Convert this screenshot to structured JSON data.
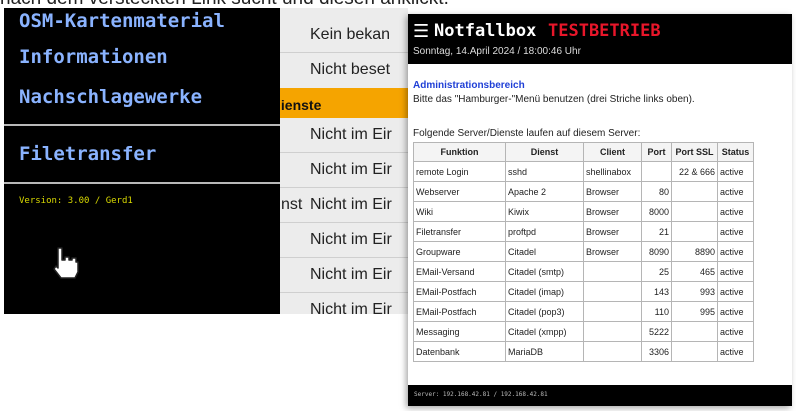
{
  "caption": "nach dem versteckten Link sucht und diesen anklickt.",
  "left_menu": {
    "items": [
      "OSM-Kartenmaterial",
      "Informationen",
      "Nachschlagewerke",
      "Filetransfer"
    ],
    "version": "Version: 3.00 / Gerd1",
    "pointer_icon": "hand-pointer-icon",
    "colors": {
      "background": "#000000",
      "text": "#8ab3ff",
      "version": "#d8d800"
    }
  },
  "middle_list": {
    "rows": [
      "Kein bekan",
      "Nicht beset",
      "lienste",
      "Nicht im Eir",
      "Nicht im Eir",
      "Nicht im Eir",
      "Nicht im Eir",
      "Nicht im Eir",
      "Nicht im Eir"
    ],
    "partial_left_text": "nst",
    "highlight_color": "#f5a400"
  },
  "notfallbox": {
    "menu_icon": "hamburger-menu-icon",
    "title": "Notfallbox",
    "badge": "TESTBETRIEB",
    "datetime": "Sonntag, 14.April 2024 / 18:00:46 Uhr",
    "admin_heading": "Administrationsbereich",
    "admin_hint": "Bitte das \"Hamburger-\"Menü benutzen (drei Striche links oben).",
    "servers_intro": "Folgende Server/Dienste laufen auf diesem Server:",
    "table": {
      "headers": [
        "Funktion",
        "Dienst",
        "Client",
        "Port",
        "Port SSL",
        "Status"
      ],
      "rows": [
        [
          "remote Login",
          "sshd",
          "shellinabox",
          "",
          "22 & 666",
          "active"
        ],
        [
          "Webserver",
          "Apache 2",
          "Browser",
          "80",
          "",
          "active"
        ],
        [
          "Wiki",
          "Kiwix",
          "Browser",
          "8000",
          "",
          "active"
        ],
        [
          "Filetransfer",
          "proftpd",
          "Browser",
          "21",
          "",
          "active"
        ],
        [
          "Groupware",
          "Citadel",
          "Browser",
          "8090",
          "8890",
          "active"
        ],
        [
          "EMail-Versand",
          "Citadel (smtp)",
          "",
          "25",
          "465",
          "active"
        ],
        [
          "EMail-Postfach",
          "Citadel (imap)",
          "",
          "143",
          "993",
          "active"
        ],
        [
          "EMail-Postfach",
          "Citadel (pop3)",
          "",
          "110",
          "995",
          "active"
        ],
        [
          "Messaging",
          "Citadel (xmpp)",
          "",
          "5222",
          "",
          "active"
        ],
        [
          "Datenbank",
          "MariaDB",
          "",
          "3306",
          "",
          "active"
        ]
      ]
    },
    "footer": "Server: 192.168.42.81 / 192.168.42.81",
    "colors": {
      "header_bg": "#000000",
      "badge": "#e8162a",
      "admin_heading": "#1f3fd6"
    }
  }
}
